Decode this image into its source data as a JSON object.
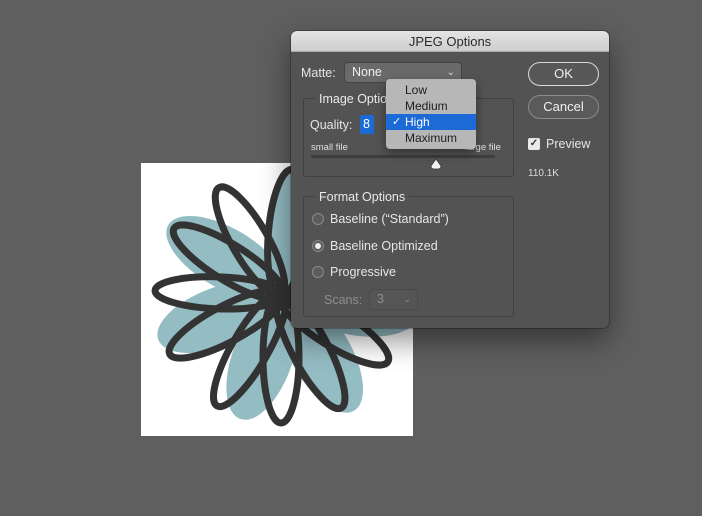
{
  "dialog": {
    "title": "JPEG Options",
    "matte_label": "Matte:",
    "matte_value": "None",
    "image_options_title": "Image Options",
    "quality_label": "Quality:",
    "quality_value": "8",
    "small_file": "small file",
    "large_file": "large file",
    "format_options_title": "Format Options",
    "formats": [
      {
        "label": "Baseline (“Standard”)",
        "checked": false
      },
      {
        "label": "Baseline Optimized",
        "checked": true
      },
      {
        "label": "Progressive",
        "checked": false
      }
    ],
    "scans_label": "Scans:",
    "scans_value": "3",
    "ok_label": "OK",
    "cancel_label": "Cancel",
    "preview_label": "Preview",
    "preview_checked": true,
    "file_size": "110.1K"
  },
  "quality_menu": {
    "items": [
      "Low",
      "Medium",
      "High",
      "Maximum"
    ],
    "selected": "High",
    "check_glyph": "✓"
  },
  "icons": {
    "matte_chevron": "chevron-down-icon",
    "scans_chevron": "chevron-down-icon",
    "slider_thumb": "triangle-thumb-icon"
  },
  "colors": {
    "workspace": "#5f5f5f",
    "dialog_bg": "#535353",
    "accent_blue": "#1c6ad6",
    "flower_fill": "#94bcc3",
    "flower_stroke": "#333333"
  }
}
